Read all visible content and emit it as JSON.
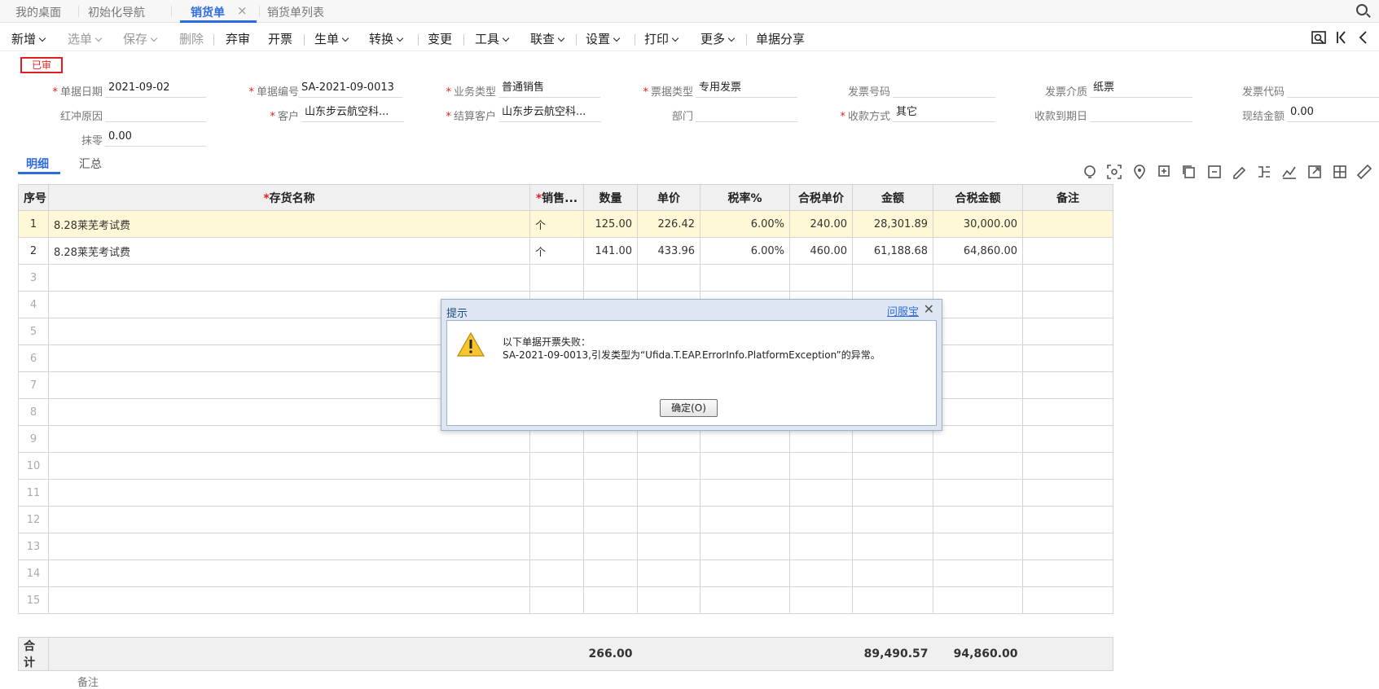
{
  "tabs": [
    {
      "label": "我的桌面"
    },
    {
      "label": "初始化导航"
    },
    {
      "label": "销货单"
    },
    {
      "label": "销货单列表"
    }
  ],
  "toolbar": {
    "add": "新增",
    "select": "选单",
    "save": "保存",
    "delete": "删除",
    "abandon": "弃审",
    "invoice": "开票",
    "generate": "生单",
    "convert": "转换",
    "change": "变更",
    "tools": "工具",
    "query": "联查",
    "settings": "设置",
    "print": "打印",
    "more": "更多",
    "share": "单据分享"
  },
  "status_badge": "已审",
  "fields": {
    "doc_date": {
      "label": "单据日期",
      "value": "2021-09-02"
    },
    "doc_no": {
      "label": "单据编号",
      "value": "SA-2021-09-0013"
    },
    "biz_type": {
      "label": "业务类型",
      "value": "普通销售"
    },
    "ticket_type": {
      "label": "票据类型",
      "value": "专用发票"
    },
    "invoice_no": {
      "label": "发票号码",
      "value": ""
    },
    "invoice_medium": {
      "label": "发票介质",
      "value": "纸票"
    },
    "invoice_code": {
      "label": "发票代码",
      "value": ""
    },
    "red_reason": {
      "label": "红冲原因",
      "value": ""
    },
    "customer": {
      "label": "客户",
      "value": "山东步云航空科..."
    },
    "settle_customer": {
      "label": "结算客户",
      "value": "山东步云航空科..."
    },
    "department": {
      "label": "部门",
      "value": ""
    },
    "pay_method": {
      "label": "收款方式",
      "value": "其它"
    },
    "pay_due": {
      "label": "收款到期日",
      "value": ""
    },
    "cash_amount": {
      "label": "现结金额",
      "value": "0.00"
    },
    "rounding": {
      "label": "抹零",
      "value": "0.00"
    }
  },
  "subtabs": {
    "detail": "明细",
    "summary": "汇总"
  },
  "grid": {
    "headers": [
      "序号",
      "存货名称",
      "销售...",
      "数量",
      "单价",
      "税率%",
      "合税单价",
      "金额",
      "合税金额",
      "备注"
    ],
    "rows": [
      {
        "idx": "1",
        "name": "8.28莱芜考试费",
        "unit": "个",
        "qty": "125.00",
        "price": "226.42",
        "tax": "6.00%",
        "tax_price": "240.00",
        "amount": "28,301.89",
        "tax_amount": "30,000.00",
        "remark": ""
      },
      {
        "idx": "2",
        "name": "8.28莱芜考试费",
        "unit": "个",
        "qty": "141.00",
        "price": "433.96",
        "tax": "6.00%",
        "tax_price": "460.00",
        "amount": "61,188.68",
        "tax_amount": "64,860.00",
        "remark": ""
      }
    ],
    "empty_rows": [
      "3",
      "4",
      "5",
      "6",
      "7",
      "8",
      "9",
      "10",
      "11",
      "12",
      "13",
      "14",
      "15"
    ]
  },
  "totals": {
    "label": "合计",
    "qty": "266.00",
    "amount": "89,490.57",
    "tax_amount": "94,860.00"
  },
  "remark_label": "备注",
  "dialog": {
    "title": "提示",
    "help_link": "问服宝",
    "line1": "以下单据开票失败：",
    "line2": "SA-2021-09-0013,引发类型为“Ufida.T.EAP.ErrorInfo.PlatformException”的异常。",
    "ok": "确定(O)"
  },
  "colors": {
    "accent": "#2d6cdf",
    "required": "#e02020",
    "selected_row": "#fff8d6"
  }
}
